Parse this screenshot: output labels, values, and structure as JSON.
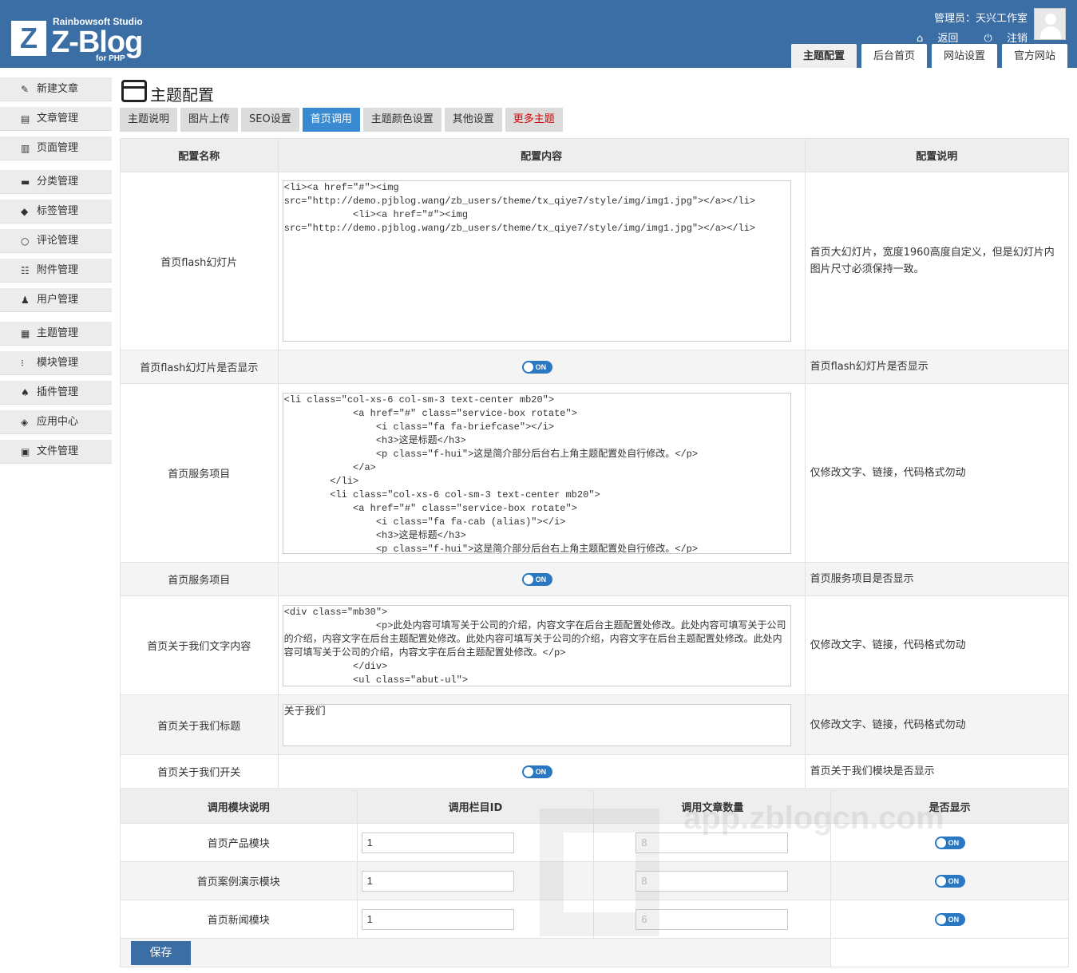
{
  "brand": {
    "studio": "Rainbowsoft Studio",
    "name": "Z-Blog",
    "sub": "for PHP",
    "logo_letter": "Z"
  },
  "header": {
    "user_label": "管理员：天兴工作室",
    "back": "返回",
    "logout": "注销",
    "tabs": [
      "主题配置",
      "后台首页",
      "网站设置",
      "官方网站"
    ],
    "active_tab": "主题配置"
  },
  "sidebar": {
    "items": [
      {
        "label": "新建文章",
        "icon": "edit-icon"
      },
      {
        "label": "文章管理",
        "icon": "file-icon"
      },
      {
        "label": "页面管理",
        "icon": "page-icon"
      },
      {
        "label": "分类管理",
        "icon": "folder-icon"
      },
      {
        "label": "标签管理",
        "icon": "tag-icon"
      },
      {
        "label": "评论管理",
        "icon": "comment-icon"
      },
      {
        "label": "附件管理",
        "icon": "attachment-icon"
      },
      {
        "label": "用户管理",
        "icon": "user-icon"
      },
      {
        "label": "主题管理",
        "icon": "theme-icon"
      },
      {
        "label": "模块管理",
        "icon": "module-icon"
      },
      {
        "label": "插件管理",
        "icon": "plugin-icon"
      },
      {
        "label": "应用中心",
        "icon": "app-center-icon"
      },
      {
        "label": "文件管理",
        "icon": "file-manage-icon"
      }
    ]
  },
  "page": {
    "title": "主题配置",
    "tabs": [
      "主题说明",
      "图片上传",
      "SEO设置",
      "首页调用",
      "主题颜色设置",
      "其他设置",
      "更多主题"
    ],
    "active_tab": "首页调用",
    "highlight_tab": "更多主题"
  },
  "config_table": {
    "headers": [
      "配置名称",
      "配置内容",
      "配置说明"
    ],
    "rows": [
      {
        "name": "首页flash幻灯片",
        "type": "textarea",
        "value": "<li><a href=\"#\"><img src=\"http://demo.pjblog.wang/zb_users/theme/tx_qiye7/style/img/img1.jpg\"></a></li>\n            <li><a href=\"#\"><img src=\"http://demo.pjblog.wang/zb_users/theme/tx_qiye7/style/img/img1.jpg\"></a></li>",
        "desc": "首页大幻灯片，宽度1960高度自定义，但是幻灯片内图片尺寸必须保持一致。"
      },
      {
        "name": "首页flash幻灯片是否显示",
        "type": "toggle",
        "value": "ON",
        "desc": "首页flash幻灯片是否显示"
      },
      {
        "name": "首页服务项目",
        "type": "textarea",
        "value": "<li class=\"col-xs-6 col-sm-3 text-center mb20\">\n            <a href=\"#\" class=\"service-box rotate\">\n                <i class=\"fa fa-briefcase\"></i>\n                <h3>这是标题</h3>\n                <p class=\"f-hui\">这是简介部分后台右上角主题配置处自行修改。</p>\n            </a>\n        </li>\n        <li class=\"col-xs-6 col-sm-3 text-center mb20\">\n            <a href=\"#\" class=\"service-box rotate\">\n                <i class=\"fa fa-cab (alias)\"></i>\n                <h3>这是标题</h3>\n                <p class=\"f-hui\">这是简介部分后台右上角主题配置处自行修改。</p>",
        "desc": "仅修改文字、链接，代码格式勿动"
      },
      {
        "name": "首页服务项目",
        "type": "toggle",
        "value": "ON",
        "desc": "首页服务项目是否显示"
      },
      {
        "name": "首页关于我们文字内容",
        "type": "textarea",
        "value": "<div class=\"mb30\">\n                <p>此处内容可填写关于公司的介绍，内容文字在后台主题配置处修改。此处内容可填写关于公司的介绍，内容文字在后台主题配置处修改。此处内容可填写关于公司的介绍，内容文字在后台主题配置处修改。此处内容可填写关于公司的介绍，内容文字在后台主题配置处修改。</p>\n            </div>\n            <ul class=\"abut-ul\">",
        "desc": "仅修改文字、链接，代码格式勿动"
      },
      {
        "name": "首页关于我们标题",
        "type": "textarea",
        "value": "关于我们",
        "desc": "仅修改文字、链接，代码格式勿动"
      },
      {
        "name": "首页关于我们开关",
        "type": "toggle",
        "value": "ON",
        "desc": "首页关于我们模块是否显示"
      }
    ]
  },
  "module_table": {
    "headers": [
      "调用模块说明",
      "调用栏目ID",
      "调用文章数量",
      "是否显示"
    ],
    "rows": [
      {
        "name": "首页产品模块",
        "cat_id": "1",
        "count": "8",
        "show": "ON"
      },
      {
        "name": "首页案例演示模块",
        "cat_id": "1",
        "count": "8",
        "show": "ON"
      },
      {
        "name": "首页新闻模块",
        "cat_id": "1",
        "count": "6",
        "show": "ON"
      }
    ]
  },
  "save_label": "保存",
  "watermark": "app.zblogcn.com",
  "colors": {
    "header_bg": "#3a6ea5",
    "active_tab": "#3a8ad2",
    "toggle_on": "#2a78c2",
    "more_theme": "#dd0000"
  }
}
